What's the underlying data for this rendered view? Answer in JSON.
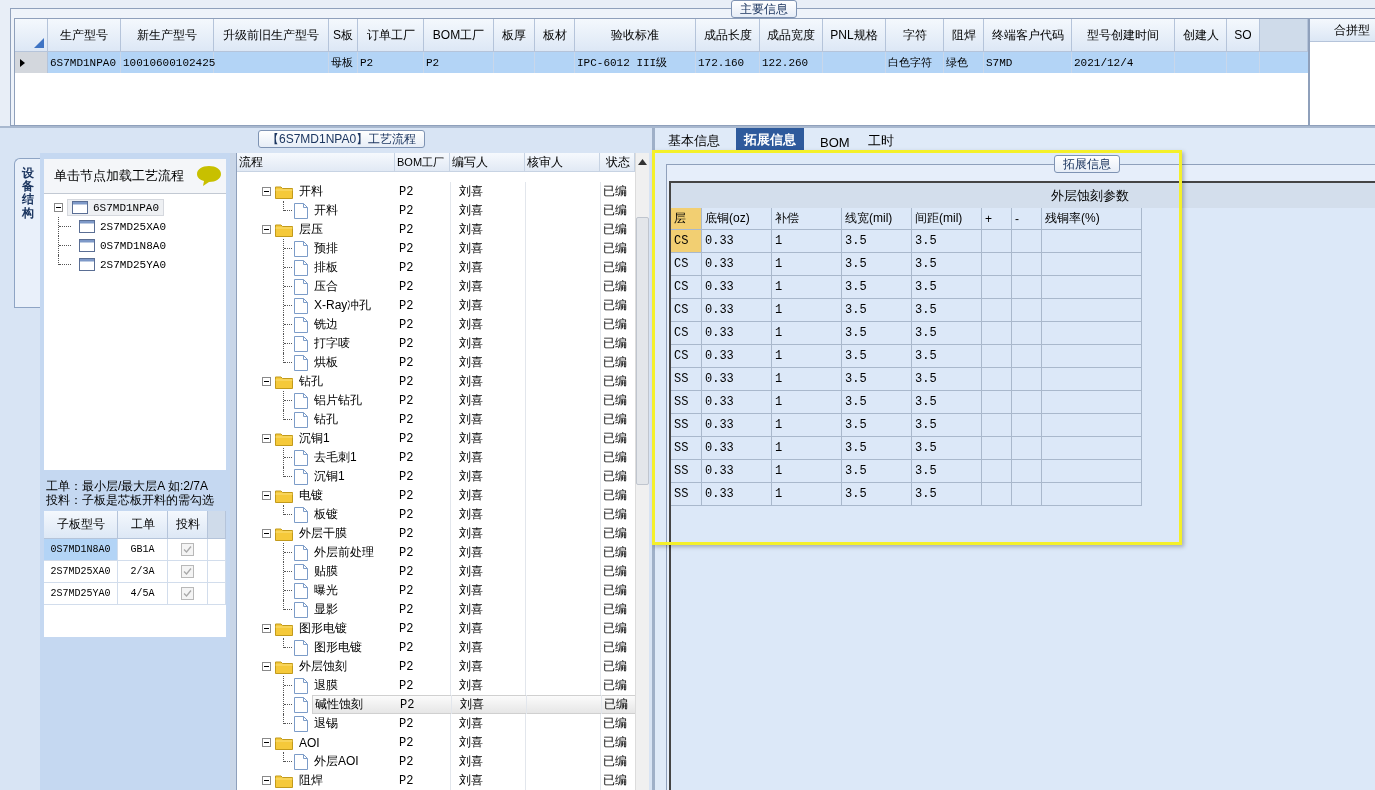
{
  "main_info": {
    "group_title": "主要信息",
    "columns": [
      "生产型号",
      "新生产型号",
      "升级前旧生产型号",
      "S板",
      "订单工厂",
      "BOM工厂",
      "板厚",
      "板材",
      "验收标准",
      "成品长度",
      "成品宽度",
      "PNL规格",
      "字符",
      "阻焊",
      "终端客户代码",
      "型号创建时间",
      "创建人",
      "SO"
    ],
    "rows": [
      {
        "selected": true,
        "cells": [
          "6S7MD1NPA0",
          "10010600102425",
          "",
          "母板",
          "P2",
          "P2",
          "",
          "",
          "IPC-6012 III级",
          "172.160",
          "122.260",
          "",
          "白色字符",
          "绿色",
          "S7MD",
          "2021/12/4",
          "",
          ""
        ]
      }
    ]
  },
  "merge_panel": {
    "header": "合拼型"
  },
  "process_panel": {
    "title": "【6S7MD1NPA0】工艺流程",
    "side_tab": "设备结构",
    "hint": "单击节点加载工艺流程",
    "board_tree": {
      "label": "6S7MD1NPA0",
      "expanded": true,
      "selected": true,
      "children": [
        {
          "label": "2S7MD25XA0",
          "selected": false
        },
        {
          "label": "0S7MD1N8A0",
          "selected": false
        },
        {
          "label": "2S7MD25YA0",
          "selected": false
        }
      ]
    },
    "notes": [
      "工单：最小层/最大层A 如:2/7A",
      "投料：子板是芯板开料的需勾选"
    ],
    "sub_table": {
      "columns": [
        "子板型号",
        "工单",
        "投料"
      ],
      "rows": [
        {
          "model": "0S7MD1N8A0",
          "order": "GB1A",
          "feed_checked": true,
          "selected": true
        },
        {
          "model": "2S7MD25XA0",
          "order": "2/3A",
          "feed_checked": true,
          "selected": false
        },
        {
          "model": "2S7MD25YA0",
          "order": "4/5A",
          "feed_checked": true,
          "selected": false
        }
      ]
    },
    "flow": {
      "columns": [
        "流程",
        "BOM工厂",
        "编写人",
        "核审人",
        "状态"
      ],
      "rows": [
        {
          "kind": "folder",
          "label": "开料",
          "bom": "P2",
          "writer": "刘喜",
          "status": "已编",
          "expanded": true,
          "selected": false,
          "children": [
            {
              "kind": "file",
              "label": "开料",
              "bom": "P2",
              "writer": "刘喜",
              "status": "已编",
              "selected": false
            }
          ]
        },
        {
          "kind": "folder",
          "label": "层压",
          "bom": "P2",
          "writer": "刘喜",
          "status": "已编",
          "expanded": true,
          "selected": false,
          "children": [
            {
              "kind": "file",
              "label": "预排",
              "bom": "P2",
              "writer": "刘喜",
              "status": "已编",
              "selected": false
            },
            {
              "kind": "file",
              "label": "排板",
              "bom": "P2",
              "writer": "刘喜",
              "status": "已编",
              "selected": false
            },
            {
              "kind": "file",
              "label": "压合",
              "bom": "P2",
              "writer": "刘喜",
              "status": "已编",
              "selected": false
            },
            {
              "kind": "file",
              "label": "X-Ray冲孔",
              "bom": "P2",
              "writer": "刘喜",
              "status": "已编",
              "selected": false
            },
            {
              "kind": "file",
              "label": "铣边",
              "bom": "P2",
              "writer": "刘喜",
              "status": "已编",
              "selected": false
            },
            {
              "kind": "file",
              "label": "打字唛",
              "bom": "P2",
              "writer": "刘喜",
              "status": "已编",
              "selected": false
            },
            {
              "kind": "file",
              "label": "烘板",
              "bom": "P2",
              "writer": "刘喜",
              "status": "已编",
              "selected": false
            }
          ]
        },
        {
          "kind": "folder",
          "label": "钻孔",
          "bom": "P2",
          "writer": "刘喜",
          "status": "已编",
          "expanded": true,
          "selected": false,
          "children": [
            {
              "kind": "file",
              "label": "铝片钻孔",
              "bom": "P2",
              "writer": "刘喜",
              "status": "已编",
              "selected": false
            },
            {
              "kind": "file",
              "label": "钻孔",
              "bom": "P2",
              "writer": "刘喜",
              "status": "已编",
              "selected": false
            }
          ]
        },
        {
          "kind": "folder",
          "label": "沉铜1",
          "bom": "P2",
          "writer": "刘喜",
          "status": "已编",
          "expanded": true,
          "selected": false,
          "children": [
            {
              "kind": "file",
              "label": "去毛刺1",
              "bom": "P2",
              "writer": "刘喜",
              "status": "已编",
              "selected": false
            },
            {
              "kind": "file",
              "label": "沉铜1",
              "bom": "P2",
              "writer": "刘喜",
              "status": "已编",
              "selected": false
            }
          ]
        },
        {
          "kind": "folder",
          "label": "电镀",
          "bom": "P2",
          "writer": "刘喜",
          "status": "已编",
          "expanded": true,
          "selected": false,
          "children": [
            {
              "kind": "file",
              "label": "板镀",
              "bom": "P2",
              "writer": "刘喜",
              "status": "已编",
              "selected": false
            }
          ]
        },
        {
          "kind": "folder",
          "label": "外层干膜",
          "bom": "P2",
          "writer": "刘喜",
          "status": "已编",
          "expanded": true,
          "selected": false,
          "children": [
            {
              "kind": "file",
              "label": "外层前处理",
              "bom": "P2",
              "writer": "刘喜",
              "status": "已编",
              "selected": false
            },
            {
              "kind": "file",
              "label": "贴膜",
              "bom": "P2",
              "writer": "刘喜",
              "status": "已编",
              "selected": false
            },
            {
              "kind": "file",
              "label": "曝光",
              "bom": "P2",
              "writer": "刘喜",
              "status": "已编",
              "selected": false
            },
            {
              "kind": "file",
              "label": "显影",
              "bom": "P2",
              "writer": "刘喜",
              "status": "已编",
              "selected": false
            }
          ]
        },
        {
          "kind": "folder",
          "label": "图形电镀",
          "bom": "P2",
          "writer": "刘喜",
          "status": "已编",
          "expanded": true,
          "selected": false,
          "children": [
            {
              "kind": "file",
              "label": "图形电镀",
              "bom": "P2",
              "writer": "刘喜",
              "status": "已编",
              "selected": false
            }
          ]
        },
        {
          "kind": "folder",
          "label": "外层蚀刻",
          "bom": "P2",
          "writer": "刘喜",
          "status": "已编",
          "expanded": true,
          "selected": false,
          "children": [
            {
              "kind": "file",
              "label": "退膜",
              "bom": "P2",
              "writer": "刘喜",
              "status": "已编",
              "selected": false
            },
            {
              "kind": "file",
              "label": "碱性蚀刻",
              "bom": "P2",
              "writer": "刘喜",
              "status": "已编",
              "selected": true
            },
            {
              "kind": "file",
              "label": "退锡",
              "bom": "P2",
              "writer": "刘喜",
              "status": "已编",
              "selected": false
            }
          ]
        },
        {
          "kind": "folder",
          "label": "AOI",
          "bom": "P2",
          "writer": "刘喜",
          "status": "已编",
          "expanded": true,
          "selected": false,
          "children": [
            {
              "kind": "file",
              "label": "外层AOI",
              "bom": "P2",
              "writer": "刘喜",
              "status": "已编",
              "selected": false
            }
          ]
        },
        {
          "kind": "folder",
          "label": "阻焊",
          "bom": "P2",
          "writer": "刘喜",
          "status": "已编",
          "expanded": true,
          "selected": false
        }
      ]
    }
  },
  "detail_panel": {
    "tabs": [
      {
        "label": "基本信息",
        "selected": false
      },
      {
        "label": "拓展信息",
        "selected": true
      },
      {
        "label": "BOM",
        "selected": false
      },
      {
        "label": "工时",
        "selected": false
      }
    ],
    "group_title": "拓展信息",
    "table": {
      "title": "外层蚀刻参数",
      "columns": [
        "层",
        "底铜(oz)",
        "补偿",
        "线宽(mil)",
        "间距(mil)",
        "+",
        "-",
        "残铜率(%)"
      ],
      "rows": [
        {
          "selected": true,
          "cells": [
            "CS",
            "0.33",
            "1",
            "3.5",
            "3.5"
          ]
        },
        {
          "selected": false,
          "cells": [
            "CS",
            "0.33",
            "1",
            "3.5",
            "3.5"
          ]
        },
        {
          "selected": false,
          "cells": [
            "CS",
            "0.33",
            "1",
            "3.5",
            "3.5"
          ]
        },
        {
          "selected": false,
          "cells": [
            "CS",
            "0.33",
            "1",
            "3.5",
            "3.5"
          ]
        },
        {
          "selected": false,
          "cells": [
            "CS",
            "0.33",
            "1",
            "3.5",
            "3.5"
          ]
        },
        {
          "selected": false,
          "cells": [
            "CS",
            "0.33",
            "1",
            "3.5",
            "3.5"
          ]
        },
        {
          "selected": false,
          "cells": [
            "SS",
            "0.33",
            "1",
            "3.5",
            "3.5"
          ]
        },
        {
          "selected": false,
          "cells": [
            "SS",
            "0.33",
            "1",
            "3.5",
            "3.5"
          ]
        },
        {
          "selected": false,
          "cells": [
            "SS",
            "0.33",
            "1",
            "3.5",
            "3.5"
          ]
        },
        {
          "selected": false,
          "cells": [
            "SS",
            "0.33",
            "1",
            "3.5",
            "3.5"
          ]
        },
        {
          "selected": false,
          "cells": [
            "SS",
            "0.33",
            "1",
            "3.5",
            "3.5"
          ]
        },
        {
          "selected": false,
          "cells": [
            "SS",
            "0.33",
            "1",
            "3.5",
            "3.5"
          ]
        }
      ]
    }
  }
}
